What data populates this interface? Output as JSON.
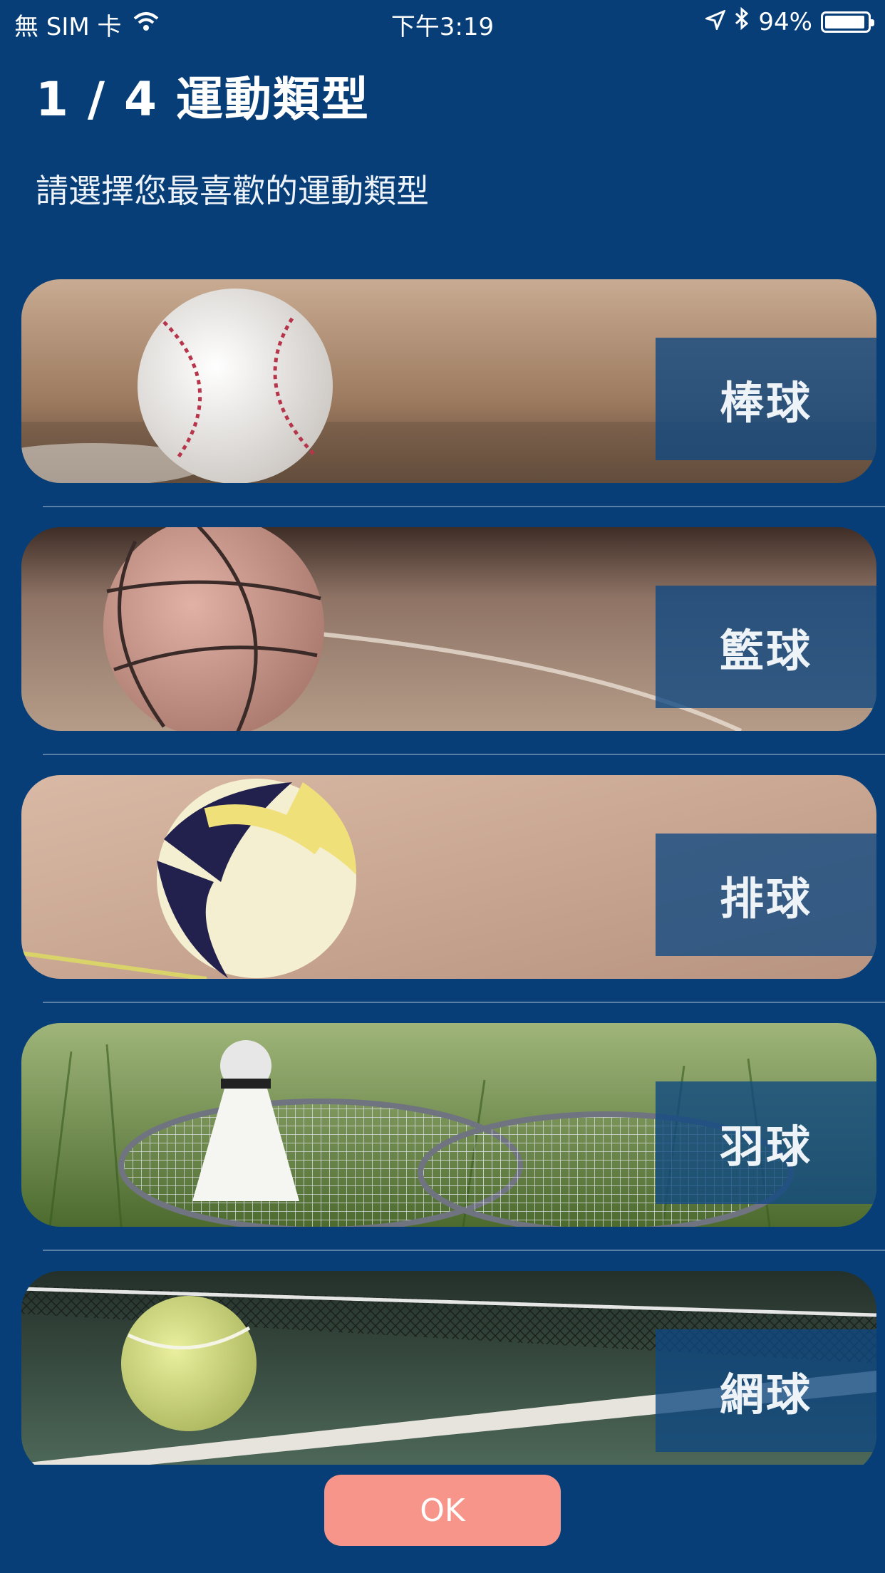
{
  "status_bar": {
    "carrier": "無 SIM 卡",
    "time": "下午3:19",
    "battery_pct": "94%",
    "battery_level": 0.94
  },
  "header": {
    "title": "1 / 4 運動類型",
    "subtitle": "請選擇您最喜歡的運動類型"
  },
  "sports": [
    {
      "label": "棒球",
      "icon": "baseball"
    },
    {
      "label": "籃球",
      "icon": "basketball"
    },
    {
      "label": "排球",
      "icon": "volleyball"
    },
    {
      "label": "羽球",
      "icon": "badminton"
    },
    {
      "label": "網球",
      "icon": "tennis"
    }
  ],
  "ok_button": {
    "label": "OK"
  },
  "colors": {
    "background": "#073e77",
    "tag_overlay": "#0e4882",
    "ok_button": "#f7958a"
  }
}
